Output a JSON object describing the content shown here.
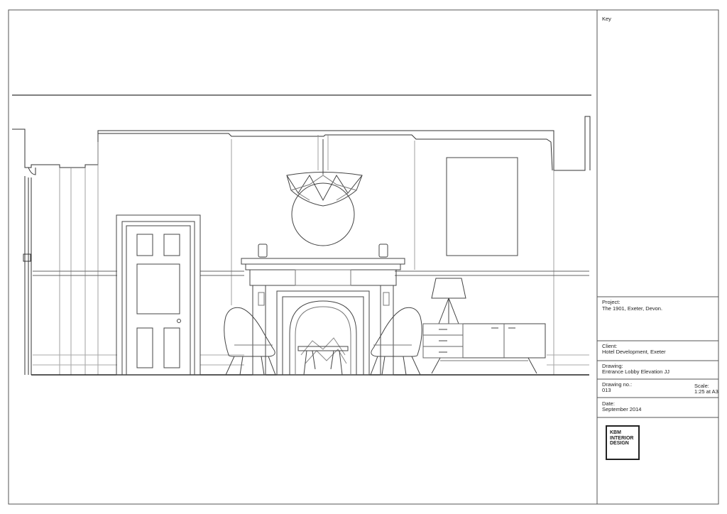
{
  "title_block": {
    "key_label": "Key",
    "project_label": "Project:",
    "project_value": "The 1901, Exeter, Devon.",
    "client_label": "Client:",
    "client_value": "Hotel Development, Exeter",
    "drawing_label": "Drawing:",
    "drawing_value": "Entrance Lobby Elevation JJ",
    "drawing_no_label": "Drawing no.:",
    "drawing_no_value": "013",
    "scale_label": "Scale:",
    "scale_value": "1:25 at A3",
    "date_label": "Date:",
    "date_value": "September 2014",
    "logo_lines": [
      "KBM",
      "INTERIOR",
      "DESIGN"
    ]
  }
}
